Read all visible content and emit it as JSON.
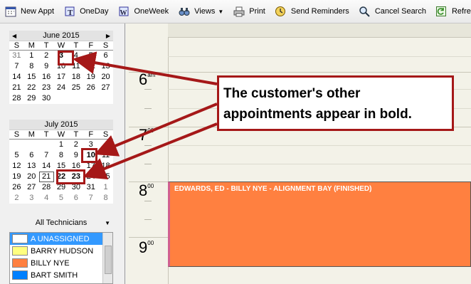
{
  "toolbar": {
    "new_appt": "New Appt",
    "one_day": "OneDay",
    "one_week": "OneWeek",
    "views": "Views",
    "print": "Print",
    "send_reminders": "Send Reminders",
    "cancel_search": "Cancel Search",
    "refresh": "Refresh"
  },
  "calendars": {
    "june": {
      "title": "June 2015",
      "dow": [
        "S",
        "M",
        "T",
        "W",
        "T",
        "F",
        "S"
      ],
      "days": [
        "31",
        "1",
        "2",
        "3",
        "4",
        "5",
        "6",
        "7",
        "8",
        "9",
        "10",
        "11",
        "12",
        "13",
        "14",
        "15",
        "16",
        "17",
        "18",
        "19",
        "20",
        "21",
        "22",
        "23",
        "24",
        "25",
        "26",
        "27",
        "28",
        "29",
        "30"
      ]
    },
    "july": {
      "title": "July 2015",
      "dow": [
        "S",
        "M",
        "T",
        "W",
        "T",
        "F",
        "S"
      ],
      "days": [
        "",
        "",
        "",
        "1",
        "2",
        "3",
        "4",
        "5",
        "6",
        "7",
        "8",
        "9",
        "10",
        "11",
        "12",
        "13",
        "14",
        "15",
        "16",
        "17",
        "18",
        "19",
        "20",
        "21",
        "22",
        "23",
        "24",
        "25",
        "26",
        "27",
        "28",
        "29",
        "30",
        "31",
        "1",
        "2",
        "3",
        "4",
        "5",
        "6",
        "7",
        "8"
      ]
    }
  },
  "technicians": {
    "selected": "All Technicians",
    "items": [
      {
        "name": "A UNASSIGNED",
        "color": "#ffffff"
      },
      {
        "name": "BARRY HUDSON",
        "color": "#ffff80"
      },
      {
        "name": "BILLY NYE",
        "color": "#ff8040"
      },
      {
        "name": "BART SMITH",
        "color": "#0080ff"
      }
    ]
  },
  "schedule": {
    "hours": [
      {
        "num": "6",
        "sup": "am"
      },
      {
        "num": "7",
        "sup": "00"
      },
      {
        "num": "8",
        "sup": "00"
      },
      {
        "num": "9",
        "sup": "00"
      }
    ],
    "appointment": {
      "text": "EDWARDS, ED - BILLY NYE - ALIGNMENT BAY (FINISHED)",
      "color": "#ff8040"
    }
  },
  "callout": {
    "line1": "The customer's other",
    "line2": "appointments appear in bold."
  },
  "colors": {
    "annotation": "#a51818"
  }
}
